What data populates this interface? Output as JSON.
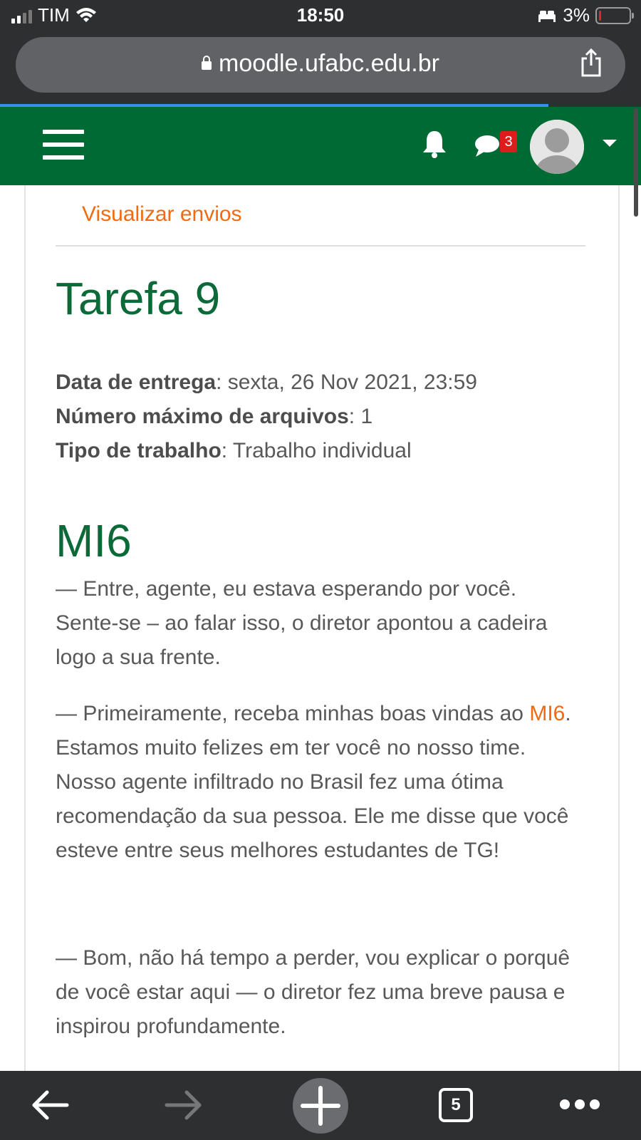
{
  "status_bar": {
    "carrier": "TIM",
    "time": "18:50",
    "battery_percent": "3%",
    "battery_level": 0.03
  },
  "browser": {
    "url": "moodle.ufabc.edu.br",
    "load_progress": 0.86,
    "tab_count": "5"
  },
  "navbar": {
    "messages_badge": "3",
    "brand_color": "#006a34"
  },
  "assignment": {
    "view_submissions_link": "Visualizar envios",
    "title": "Tarefa 9",
    "meta": [
      {
        "label": "Data de entrega",
        "value": ": sexta, 26 Nov 2021, 23:59"
      },
      {
        "label": "Número máximo de arquivos",
        "value": ": 1"
      },
      {
        "label": "Tipo de trabalho",
        "value": ": Trabalho individual"
      }
    ]
  },
  "story": {
    "heading": "MI6",
    "p1": "— Entre, agente, eu estava esperando por você. Sente-se – ao falar isso, o diretor apontou a cadeira logo a sua frente.",
    "p2_pre": "— Primeiramente, receba minhas boas vindas ao ",
    "p2_link": "MI6",
    "p2_post": ". Estamos muito felizes em ter você no nosso time. Nosso agente infiltrado no Brasil fez uma ótima recomendação da sua pessoa. Ele me disse que você esteve entre seus melhores estudantes de TG!",
    "p3": "— Bom, não há tempo a perder, vou explicar o porquê de você estar aqui — o diretor fez uma breve pausa e inspirou profundamente."
  },
  "icons": {
    "menu": "hamburger-icon",
    "notifications": "bell-icon",
    "messages": "chat-bubble-icon",
    "user": "avatar-icon",
    "share": "share-icon",
    "back": "arrow-left-icon",
    "forward": "arrow-right-icon",
    "new_tab": "plus-icon",
    "more": "ellipsis-icon"
  },
  "accent_colors": {
    "link": "#f06a12",
    "heading": "#0b6a37",
    "badge": "#e01b1b"
  }
}
